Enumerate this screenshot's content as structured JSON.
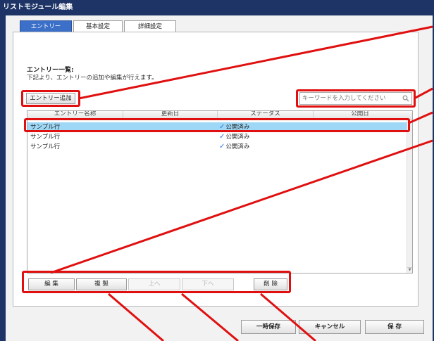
{
  "window": {
    "title": "リストモジュール編集"
  },
  "tabs": [
    {
      "label": "エントリー",
      "active": true
    },
    {
      "label": "基本設定",
      "active": false
    },
    {
      "label": "詳細設定",
      "active": false
    }
  ],
  "section": {
    "heading": "エントリー一覧:",
    "description": "下記より、エントリーの追加や編集が行えます。"
  },
  "add_button": {
    "label": "エントリー追加"
  },
  "search": {
    "placeholder": "キーワードを入力してください",
    "icon": "magnifier-icon"
  },
  "grid": {
    "columns": [
      "エントリー名称",
      "更新日",
      "ステータス",
      "公開日"
    ],
    "rows": [
      {
        "name": "サンプル行",
        "status": "公開済み",
        "selected": true
      },
      {
        "name": "サンプル行",
        "status": "公開済み",
        "selected": false
      },
      {
        "name": "サンプル行",
        "status": "公開済み",
        "selected": false
      }
    ],
    "status_icon": "check-icon"
  },
  "row_actions": [
    {
      "label": "編 集",
      "enabled": true
    },
    {
      "label": "複 製",
      "enabled": true
    },
    {
      "label": "上へ",
      "enabled": false
    },
    {
      "label": "下へ",
      "enabled": false
    },
    {
      "label": "削 除",
      "enabled": true
    }
  ],
  "footer": {
    "temp_save": "一時保存",
    "cancel": "キャンセル",
    "save": "保 存"
  },
  "colors": {
    "window_bg": "#1e3466",
    "tab_active": "#3b6fc8",
    "selected_row": "#9fd8f6",
    "callout": "#e01010"
  }
}
